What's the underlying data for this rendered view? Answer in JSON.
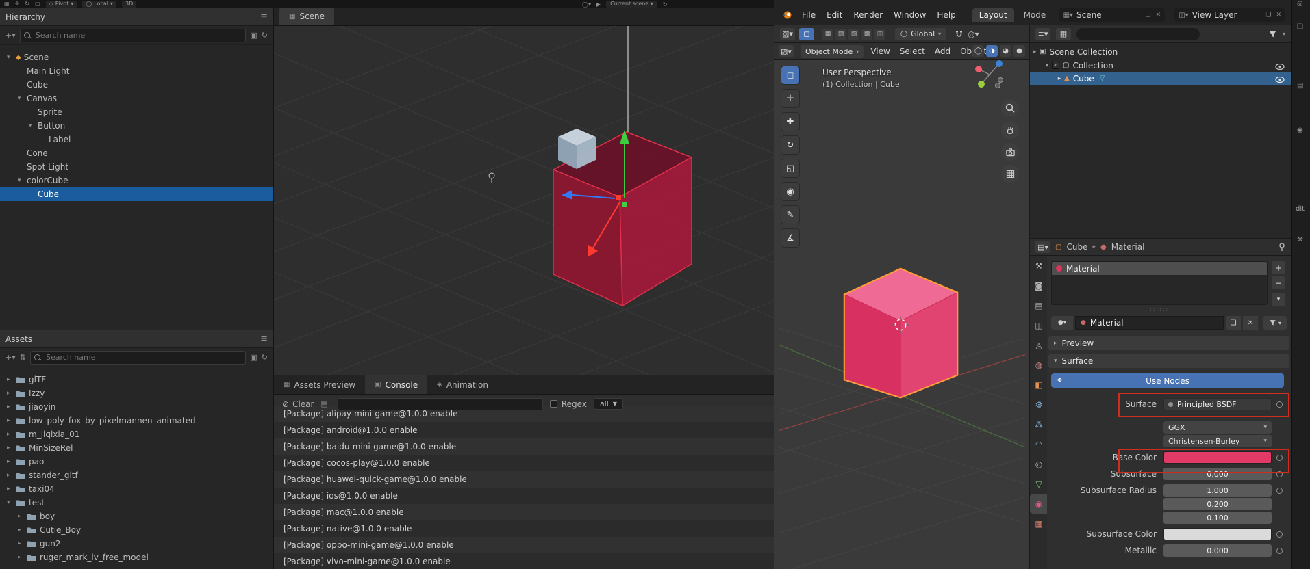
{
  "colors": {
    "accent": "#4772b3",
    "annotation": "#d02d1f",
    "cocos_selection": "#1b5c9e",
    "blender_selection": "#33628f",
    "material_red": "#e0345f",
    "cube_pink_front": "#d93062",
    "cube_pink_top": "#ef6a95",
    "cube_pink_side": "#e24472",
    "cube_outline_orange": "#ff9b38",
    "cocos_cube_left": "#8e1730",
    "cocos_cube_right": "#a11b3a",
    "cocos_cube_top": "#6b1128",
    "cocos_cube_edge": "#e03048"
  },
  "cocos": {
    "topbar": {
      "icons": [
        "▦",
        "✛",
        "↻",
        "▢"
      ],
      "pivot": "Pivot",
      "local": "Local",
      "mode3d": "3D",
      "scene_picker": "Current scene"
    },
    "hierarchy": {
      "title": "Hierarchy",
      "search_placeholder": "Search name",
      "nodes": [
        {
          "label": "Scene",
          "depth": 0,
          "arrow": "▾",
          "icon": "◆",
          "icon_color": "#e8a13c"
        },
        {
          "label": "Main Light",
          "depth": 1,
          "arrow": ""
        },
        {
          "label": "Cube",
          "depth": 1,
          "arrow": ""
        },
        {
          "label": "Canvas",
          "depth": 1,
          "arrow": "▾"
        },
        {
          "label": "Sprite",
          "depth": 2,
          "arrow": ""
        },
        {
          "label": "Button",
          "depth": 2,
          "arrow": "▾"
        },
        {
          "label": "Label",
          "depth": 3,
          "arrow": ""
        },
        {
          "label": "Cone",
          "depth": 1,
          "arrow": ""
        },
        {
          "label": "Spot Light",
          "depth": 1,
          "arrow": ""
        },
        {
          "label": "colorCube",
          "depth": 1,
          "arrow": "▾"
        },
        {
          "label": "Cube",
          "depth": 2,
          "arrow": "",
          "cls": "selected"
        }
      ]
    },
    "assets": {
      "title": "Assets",
      "search_placeholder": "Search name",
      "folders": [
        {
          "label": "glTF",
          "depth": 0,
          "arrow": "▸"
        },
        {
          "label": "Izzy",
          "depth": 0,
          "arrow": "▸"
        },
        {
          "label": "jiaoyin",
          "depth": 0,
          "arrow": "▸"
        },
        {
          "label": "low_poly_fox_by_pixelmannen_animated",
          "depth": 0,
          "arrow": "▸"
        },
        {
          "label": "m_jiqixia_01",
          "depth": 0,
          "arrow": "▸"
        },
        {
          "label": "MinSizeRel",
          "depth": 0,
          "arrow": "▸"
        },
        {
          "label": "pao",
          "depth": 0,
          "arrow": "▸"
        },
        {
          "label": "stander_gltf",
          "depth": 0,
          "arrow": "▸"
        },
        {
          "label": "taxi04",
          "depth": 0,
          "arrow": "▸"
        },
        {
          "label": "test",
          "depth": 0,
          "arrow": "▾"
        },
        {
          "label": "boy",
          "depth": 1,
          "arrow": "▸"
        },
        {
          "label": "Cutie_Boy",
          "depth": 1,
          "arrow": "▸"
        },
        {
          "label": "gun2",
          "depth": 1,
          "arrow": "▸"
        },
        {
          "label": "ruger_mark_lv_free_model",
          "depth": 1,
          "arrow": "▸"
        }
      ]
    },
    "scene": {
      "tab": "Scene"
    },
    "console": {
      "tabs": [
        {
          "label": "Assets Preview",
          "icon": "▦",
          "cls": ""
        },
        {
          "label": "Console",
          "icon": "▣",
          "cls": "active"
        },
        {
          "label": "Animation",
          "icon": "◈",
          "cls": ""
        }
      ],
      "clear": "Clear",
      "regex": "Regex",
      "filter": "all",
      "search_placeholder": "",
      "logs": [
        "[Package] alipay-mini-game@1.0.0 enable",
        "[Package] android@1.0.0 enable",
        "[Package] baidu-mini-game@1.0.0 enable",
        "[Package] cocos-play@1.0.0 enable",
        "[Package] huawei-quick-game@1.0.0 enable",
        "[Package] ios@1.0.0 enable",
        "[Package] mac@1.0.0 enable",
        "[Package] native@1.0.0 enable",
        "[Package] oppo-mini-game@1.0.0 enable",
        "[Package] vivo-mini-game@1.0.0 enable"
      ]
    }
  },
  "blender": {
    "menus": [
      "File",
      "Edit",
      "Render",
      "Window",
      "Help"
    ],
    "workspaces": [
      {
        "label": "Layout",
        "cls": "active"
      },
      {
        "label": "Model",
        "cls": "clipped"
      }
    ],
    "scene_widget": "Scene",
    "view_layer_widget": "View Layer",
    "toolsettings": {
      "select_modes": [
        "▦",
        "▧",
        "▨",
        "▩",
        "◫"
      ],
      "orientation": "Global"
    },
    "header": {
      "mode": "Object Mode",
      "menus": [
        "View",
        "Select",
        "Add",
        "Object"
      ],
      "shading": [
        {
          "glyph": "◯",
          "cls": ""
        },
        {
          "glyph": "◑",
          "cls": "active"
        },
        {
          "glyph": "◕",
          "cls": ""
        },
        {
          "glyph": "●",
          "cls": ""
        }
      ]
    },
    "tools": [
      {
        "name": "select-box-tool",
        "glyph": "◻",
        "cls": "active"
      },
      {
        "name": "cursor-tool",
        "glyph": "✛",
        "cls": ""
      },
      {
        "name": "move-tool",
        "glyph": "✚",
        "cls": ""
      },
      {
        "name": "rotate-tool",
        "glyph": "↻",
        "cls": ""
      },
      {
        "name": "scale-tool",
        "glyph": "◱",
        "cls": ""
      },
      {
        "name": "transform-tool",
        "glyph": "◉",
        "cls": ""
      },
      {
        "name": "annotate-tool",
        "glyph": "✎",
        "cls": ""
      },
      {
        "name": "measure-tool",
        "glyph": "∡",
        "cls": ""
      }
    ],
    "viewport": {
      "overlay_title": "User Perspective",
      "overlay_subtitle": "(1) Collection | Cube"
    },
    "outliner": {
      "search_placeholder": "",
      "scene_collection": "Scene Collection",
      "collection": "Collection",
      "cube": "Cube"
    },
    "properties": {
      "breadcrumb_object": "Cube",
      "breadcrumb_data": "Material",
      "slot_label": "Material",
      "name_value": "Material",
      "preview": "Preview",
      "surface": "Surface",
      "use_nodes": "Use Nodes",
      "tabs": [
        {
          "name": "tool-tab",
          "glyph": "⚒",
          "color": "#b8b8b8",
          "cls": ""
        },
        {
          "name": "render-tab",
          "glyph": "◙",
          "color": "#b0b0b0",
          "cls": ""
        },
        {
          "name": "output-tab",
          "glyph": "▤",
          "color": "#b0b0b0",
          "cls": ""
        },
        {
          "name": "view-layer-tab",
          "glyph": "◫",
          "color": "#b0b0b0",
          "cls": ""
        },
        {
          "name": "scene-tab",
          "glyph": "◬",
          "color": "#b0b0b0",
          "cls": ""
        },
        {
          "name": "world-tab",
          "glyph": "◍",
          "color": "#c98585",
          "cls": ""
        },
        {
          "name": "object-tab",
          "glyph": "◧",
          "color": "#e0914f",
          "cls": ""
        },
        {
          "name": "modifiers-tab",
          "glyph": "⚙",
          "color": "#7fa8cc",
          "cls": ""
        },
        {
          "name": "particles-tab",
          "glyph": "⁂",
          "color": "#7fa8cc",
          "cls": ""
        },
        {
          "name": "physics-tab",
          "glyph": "◠",
          "color": "#7fa8cc",
          "cls": ""
        },
        {
          "name": "constraints-tab",
          "glyph": "◎",
          "color": "#b0b0b0",
          "cls": ""
        },
        {
          "name": "object-data-tab",
          "glyph": "▽",
          "color": "#74c274",
          "cls": ""
        },
        {
          "name": "material-tab",
          "glyph": "◉",
          "color": "#e05d7f",
          "cls": "active"
        },
        {
          "name": "texture-tab",
          "glyph": "▦",
          "color": "#cf7d6a",
          "cls": ""
        }
      ],
      "rows": [
        {
          "label": "Surface",
          "value": "Principled BSDF",
          "type": "field has-socket"
        },
        {
          "label": "",
          "value": "GGX",
          "type": "drop gap-top tight"
        },
        {
          "label": "",
          "value": "Christensen-Burley",
          "type": "drop"
        },
        {
          "label": "Base Color",
          "value": "",
          "swatch": "#e23a67",
          "type": "color has-socket"
        },
        {
          "label": "Subsurface",
          "value": "0.000",
          "type": "value has-socket"
        },
        {
          "label": "Subsurface Radius",
          "value": "1.000",
          "type": "value has-socket tight"
        },
        {
          "label": "",
          "value": "0.200",
          "type": "value tight"
        },
        {
          "label": "",
          "value": "0.100",
          "type": "value"
        },
        {
          "label": "Subsurface Color",
          "value": "",
          "swatch": "#dadada",
          "type": "color has-socket"
        },
        {
          "label": "Metallic",
          "value": "0.000",
          "type": "value has-socket"
        }
      ]
    }
  },
  "background_window": {
    "icons": [
      "❏",
      "▤",
      "◉",
      "⚒",
      "◎"
    ],
    "partial_label": "dit"
  }
}
